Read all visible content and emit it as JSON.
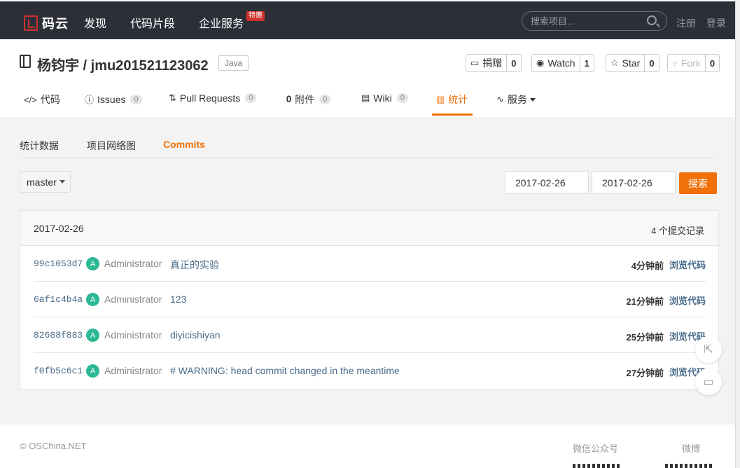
{
  "topnav": {
    "logo": "码云",
    "links": [
      "发现",
      "代码片段",
      "企业服务"
    ],
    "hot_badge": "特惠",
    "search_placeholder": "搜索项目...",
    "register": "注册",
    "login": "登录"
  },
  "repo": {
    "title": "杨钧宇 / jmu201521123062",
    "language": "Java",
    "donate": {
      "label": "捐赠",
      "count": "0"
    },
    "watch": {
      "label": "Watch",
      "count": "1"
    },
    "star": {
      "label": "Star",
      "count": "0"
    },
    "fork": {
      "label": "Fork",
      "count": "0"
    }
  },
  "tabs": {
    "code": "代码",
    "issues": {
      "label": "Issues",
      "count": "0"
    },
    "pulls": {
      "label": "Pull Requests",
      "count": "0"
    },
    "attachments": {
      "label": "附件",
      "count": "0"
    },
    "wiki": {
      "label": "Wiki",
      "count": "0"
    },
    "stats": "统计",
    "services": "服务"
  },
  "subtabs": [
    "统计数据",
    "项目网络图",
    "Commits"
  ],
  "filter": {
    "branch": "master",
    "date_from": "2017-02-26",
    "date_to": "2017-02-26",
    "search": "搜索"
  },
  "commits": {
    "date": "2017-02-26",
    "count_label": "4 个提交记录",
    "browse_label": "浏览代码",
    "rows": [
      {
        "sha": "99c1053d7",
        "avatar": "A",
        "author": "Administrator",
        "message": "真正的实验",
        "time": "4分钟前"
      },
      {
        "sha": "6af1c4b4a",
        "avatar": "A",
        "author": "Administrator",
        "message": "123",
        "time": "21分钟前"
      },
      {
        "sha": "82688f883",
        "avatar": "A",
        "author": "Administrator",
        "message": "diyicishiyan",
        "time": "25分钟前"
      },
      {
        "sha": "f0fb5c6c1",
        "avatar": "A",
        "author": "Administrator",
        "message": "# WARNING: head commit changed in the meantime",
        "time": "27分钟前"
      }
    ]
  },
  "footer": {
    "copyright": "© OSChina.NET",
    "wechat": "微信公众号",
    "weibo": "微博"
  }
}
